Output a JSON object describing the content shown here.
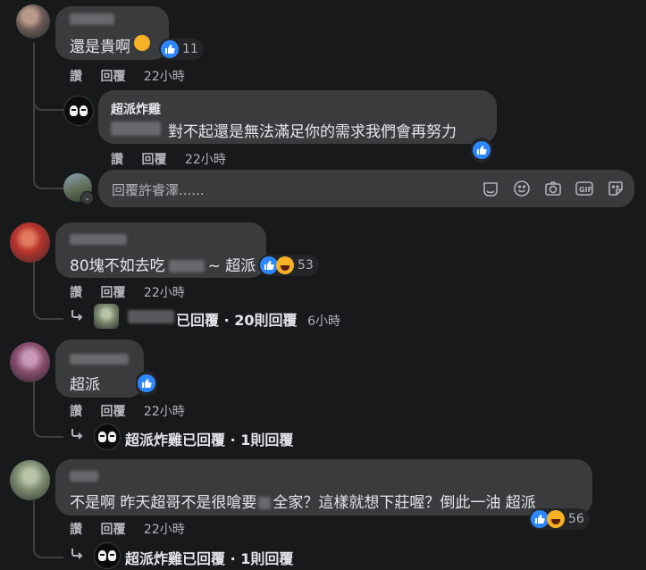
{
  "comments": [
    {
      "text": "還是貴啊",
      "like_count": "11",
      "actions": {
        "like": "讚",
        "reply": "回覆",
        "time": "22小時"
      },
      "replies": [
        {
          "author": "超派炸雞",
          "text": "對不起還是無法滿足你的需求我們會再努力",
          "actions": {
            "like": "讚",
            "reply": "回覆",
            "time": "22小時"
          }
        }
      ],
      "reply_input": {
        "placeholder": "回覆許睿澤......"
      }
    },
    {
      "text_prefix": "80塊不如去吃",
      "text_suffix": "~ 超派",
      "like_count": "53",
      "actions": {
        "like": "讚",
        "reply": "回覆",
        "time": "22小時"
      },
      "replies_summary": {
        "text": "已回覆 · 20則回覆",
        "time": "6小時"
      }
    },
    {
      "text": "超派",
      "actions": {
        "like": "讚",
        "reply": "回覆",
        "time": "22小時"
      },
      "replies_summary": {
        "author": "超派炸雞",
        "text": "已回覆 · 1則回覆"
      }
    },
    {
      "text_prefix": "不是啊 昨天超哥不是很嗆要",
      "text_suffix": "全家？這樣就想下莊喔？倒此一油 超派",
      "like_count": "56",
      "actions": {
        "like": "讚",
        "reply": "回覆",
        "time": "22小時"
      },
      "replies_summary": {
        "author": "超派炸雞",
        "text": "已回覆 · 1則回覆"
      }
    }
  ],
  "colors": {
    "background": "#18191a",
    "bubble": "#3a3b3c",
    "like_blue": "#2d88ff",
    "haha_yellow": "#f7b125",
    "secondary_text": "#b0b3b8"
  },
  "icons": [
    "like-icon",
    "haha-icon",
    "emoji-icon",
    "camera-icon",
    "gif-icon",
    "sticker-icon",
    "reply-arrow-icon"
  ]
}
